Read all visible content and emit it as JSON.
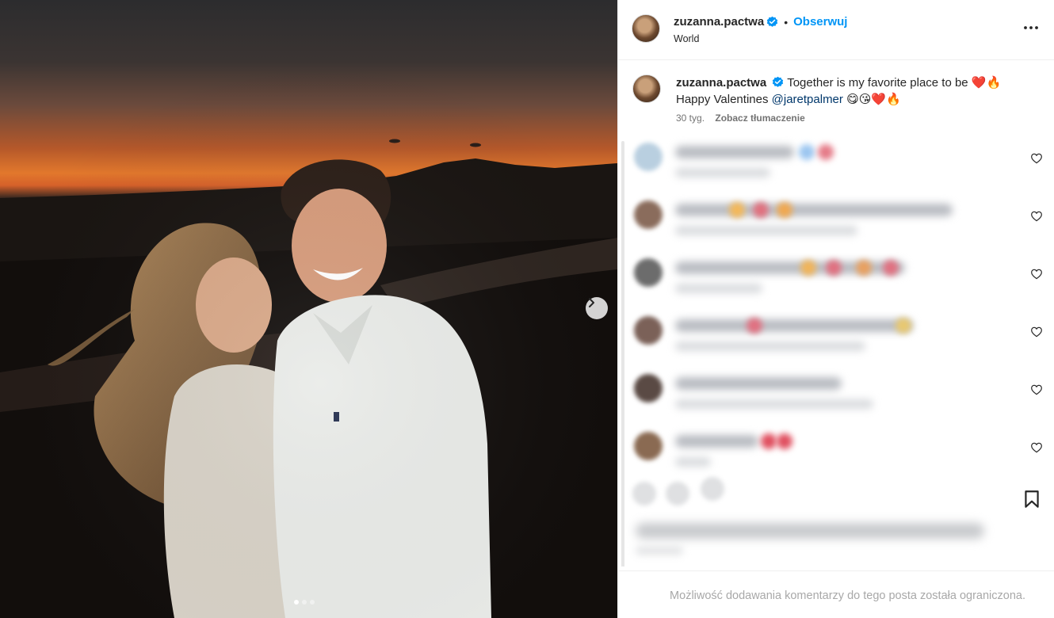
{
  "post": {
    "username": "zuzanna.pactwa",
    "follow_label": "Obserwuj",
    "bullet": "•",
    "location": "World",
    "more_icon": "more-horizontal-icon",
    "image_icon_next": "chevron-right-icon",
    "carousel": {
      "total": 3,
      "active": 1
    }
  },
  "caption": {
    "username": "zuzanna.pactwa",
    "text_line1": "Together is my favorite place to be ❤️🔥",
    "text_line2_prefix": "Happy Valentines ",
    "mention": "@jaretpalmer",
    "text_line2_suffix": " 😋😘❤️🔥",
    "age": "30 tyg.",
    "translate_label": "Zobacz tłumaczenie"
  },
  "icons": {
    "verified": "verified-badge-icon",
    "like": "heart-icon",
    "save": "bookmark-icon"
  },
  "colors": {
    "accent": "#0095f6",
    "verified": "#0095f6",
    "mention": "#00376b",
    "muted": "#737373",
    "footer_text": "#a8a8a8"
  },
  "footer": {
    "text": "Możliwość dodawania komentarzy do tego posta została ograniczona."
  }
}
